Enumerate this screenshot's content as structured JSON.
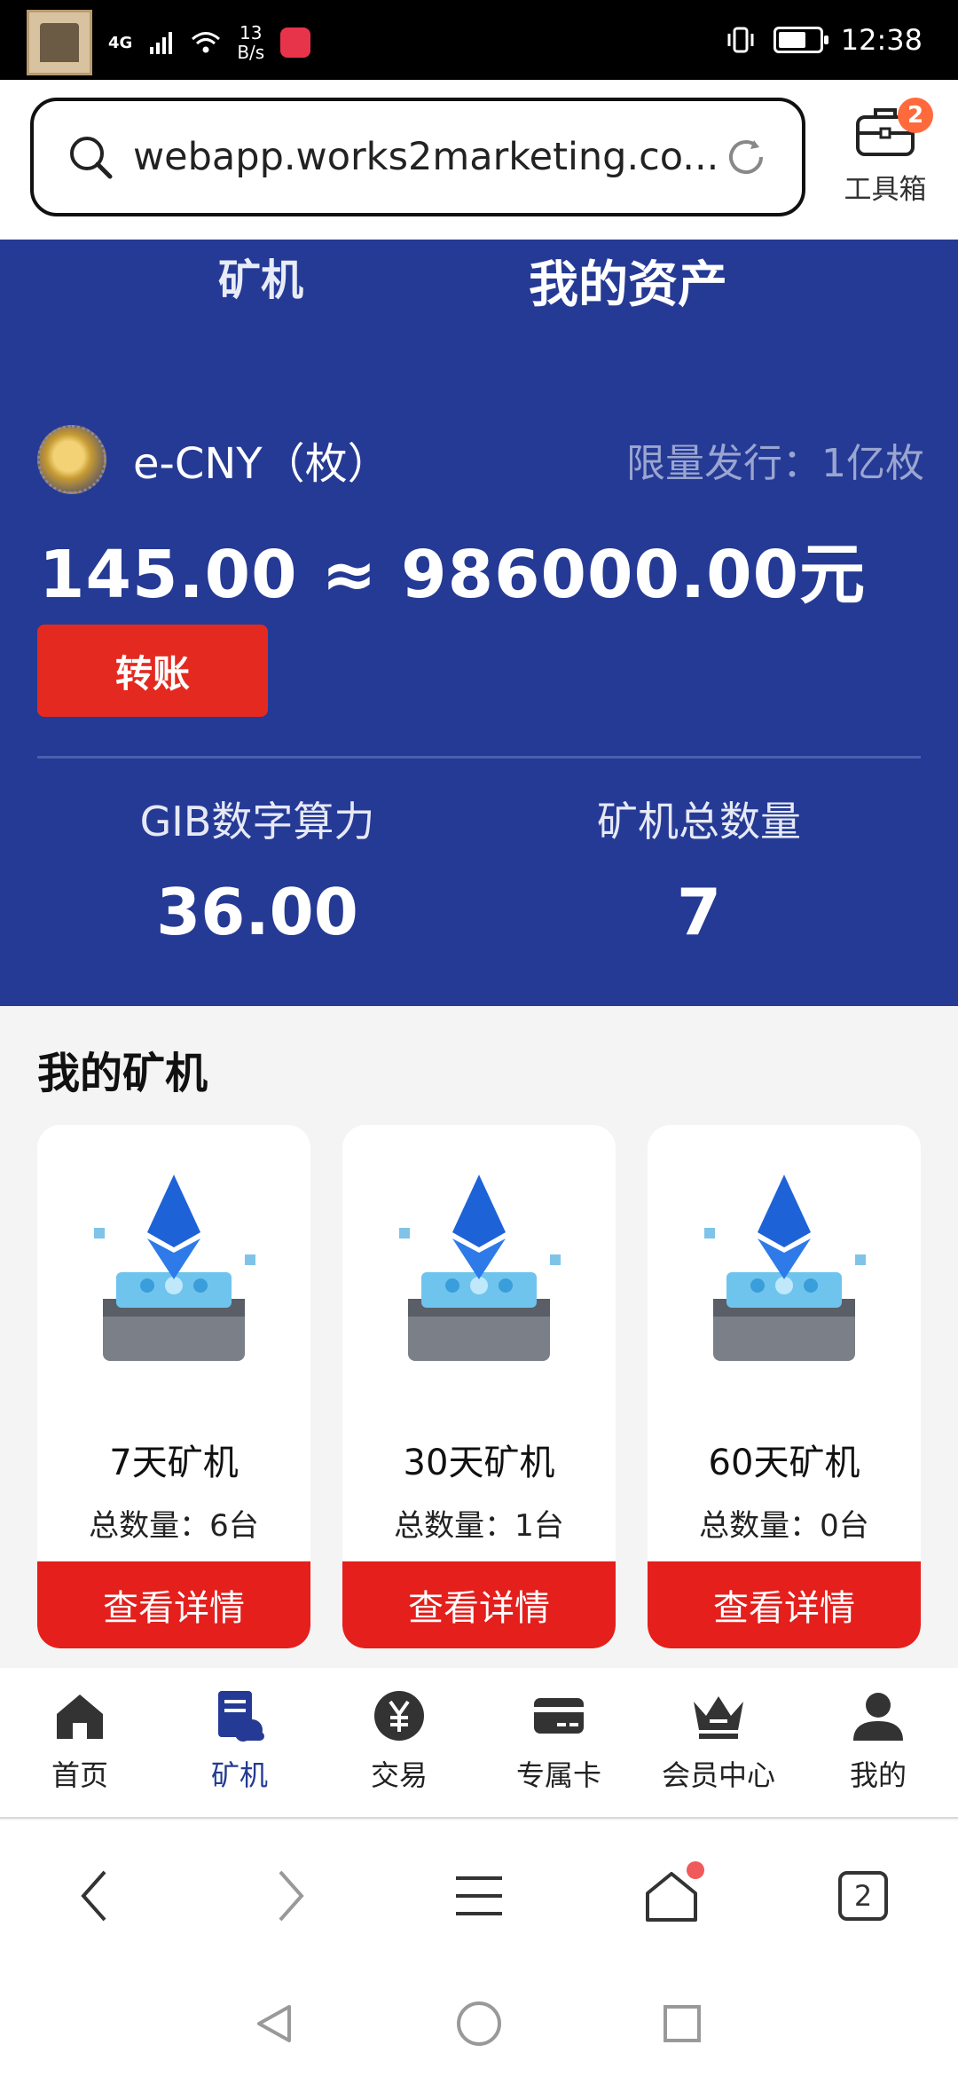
{
  "status_bar": {
    "network": "4G",
    "speed_value": "13",
    "speed_unit": "B/s",
    "time": "12:38",
    "icons": [
      "gallery-badge-icon",
      "signal-icon",
      "wifi-icon",
      "app-notification-icon",
      "vibrate-icon",
      "battery-icon"
    ]
  },
  "browser": {
    "url": "webapp.works2marketing.co...",
    "toolbox_label": "工具箱",
    "toolbox_badge": "2",
    "tab_count": "2"
  },
  "hero": {
    "tabs": [
      "矿机",
      "我的资产"
    ],
    "active_tab": "我的资产",
    "coin_name": "e-CNY（枚）",
    "limit_text": "限量发行：1亿枚",
    "amount": "145.00 ≈ 986000.00元",
    "transfer_label": "转账",
    "stats": [
      {
        "label": "GIB数字算力",
        "value": "36.00"
      },
      {
        "label": "矿机总数量",
        "value": "7"
      }
    ],
    "colors": {
      "background": "#253a94",
      "button": "#e42a20"
    }
  },
  "miners": {
    "title": "我的矿机",
    "items": [
      {
        "name": "7天矿机",
        "count": "总数量：6台",
        "button": "查看详情"
      },
      {
        "name": "30天矿机",
        "count": "总数量：1台",
        "button": "查看详情"
      },
      {
        "name": "60天矿机",
        "count": "总数量：0台",
        "button": "查看详情"
      }
    ]
  },
  "bottom_nav": {
    "items": [
      {
        "label": "首页",
        "icon": "home-icon"
      },
      {
        "label": "矿机",
        "icon": "miner-icon"
      },
      {
        "label": "交易",
        "icon": "yuan-coin-icon"
      },
      {
        "label": "专属卡",
        "icon": "card-icon"
      },
      {
        "label": "会员中心",
        "icon": "crown-icon"
      },
      {
        "label": "我的",
        "icon": "user-icon"
      }
    ],
    "active": "矿机"
  }
}
